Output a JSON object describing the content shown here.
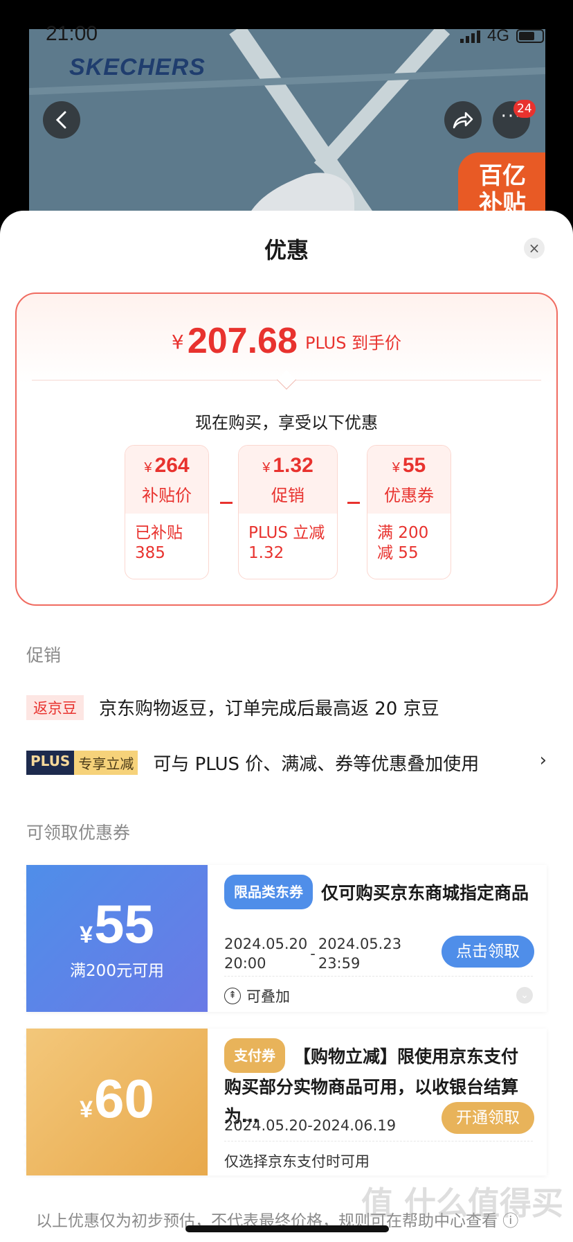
{
  "status_bar": {
    "time": "21:00",
    "network": "4G"
  },
  "product": {
    "brand": "SKECHERS",
    "more_badge": "24",
    "subsidy_label_line1": "百亿",
    "subsidy_label_line2": "补贴"
  },
  "sheet": {
    "title": "优惠",
    "close_icon": "×",
    "final_price": {
      "currency": "¥",
      "amount": "207.68",
      "label": "PLUS 到手价"
    },
    "buy_now_text": "现在购买，享受以下优惠",
    "breakdown": [
      {
        "currency": "¥",
        "amount": "264",
        "kind": "补贴价",
        "detail_line1": "已补贴",
        "detail_line2": "385"
      },
      {
        "currency": "¥",
        "amount": "1.32",
        "kind": "促销",
        "detail_line1": "PLUS 立减",
        "detail_line2": "1.32"
      },
      {
        "currency": "¥",
        "amount": "55",
        "kind": "优惠券",
        "detail_line1": "满 200",
        "detail_line2": "减 55"
      }
    ],
    "promo_section": {
      "title": "促销",
      "rows": [
        {
          "tag": "返京豆",
          "text": "京东购物返豆，订单完成后最高返 20 京豆"
        },
        {
          "tag_a": "PLUS",
          "tag_b": "专享立减",
          "text": "可与 PLUS 价、满减、券等优惠叠加使用",
          "chevron": "›"
        }
      ]
    },
    "coupon_section": {
      "title": "可领取优惠券",
      "coupons": [
        {
          "currency": "¥",
          "value": "55",
          "condition": "满200元可用",
          "tag": "限品类东券",
          "text": "仅可购买京东商城指定商品",
          "date_start": "2024.05.20",
          "time_start": "20:00",
          "date_end": "2024.05.23",
          "time_end": "23:59",
          "date_separator": "-",
          "button": "点击领取",
          "footer": "可叠加",
          "colors": {
            "tag": "#4f8ee9",
            "button": "#4f8ee9"
          }
        },
        {
          "currency": "¥",
          "value": "60",
          "tag": "支付券",
          "text": "【购物立减】限使用京东支付购买部分实物商品可用，以收银台结算为…",
          "date_range": "2024.05.20-2024.06.19",
          "button": "开通领取",
          "footer": "仅选择京东支付时可用",
          "colors": {
            "tag": "#e8b35a",
            "button": "#e8b35a"
          }
        }
      ]
    },
    "footer_note": "以上优惠仅为初步预估，不代表最终价格，规则可在帮助中心查看 ⓘ"
  },
  "watermark": "值 什么值得买"
}
